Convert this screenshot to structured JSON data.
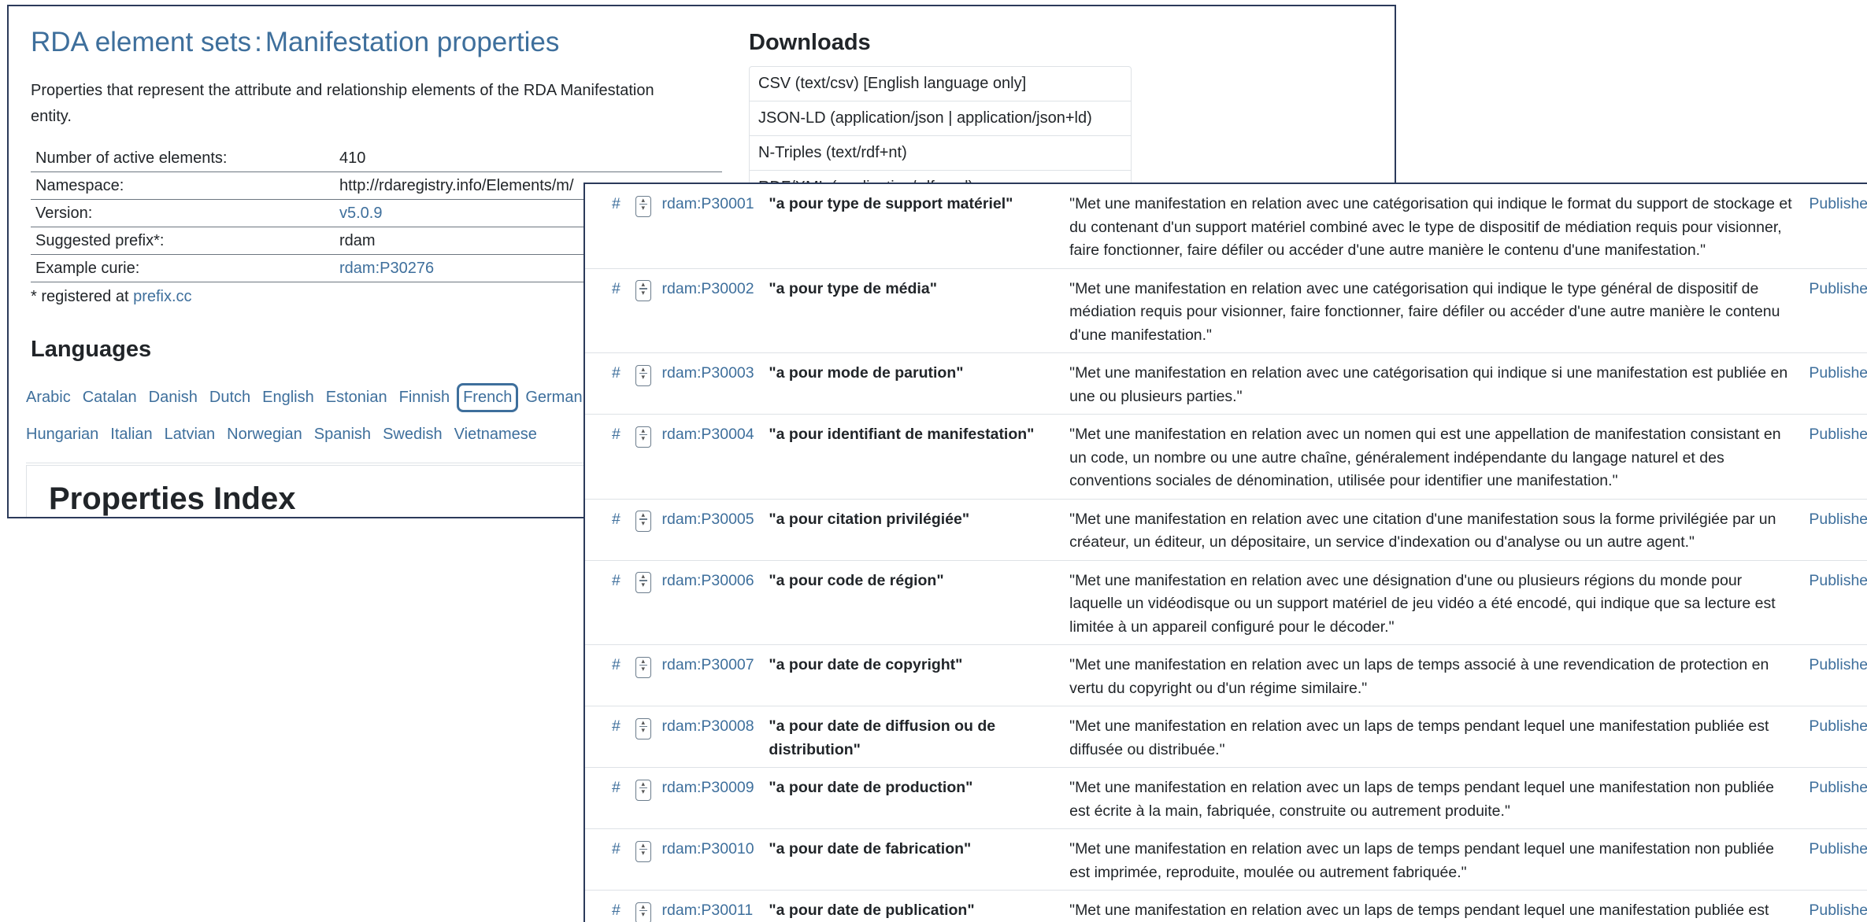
{
  "page": {
    "title_part1": "RDA element sets",
    "title_sep": ":",
    "title_part2": "Manifestation properties",
    "description": "Properties that represent the attribute and relationship elements of the RDA Manifestation entity."
  },
  "info": [
    {
      "key": "Number of active elements:",
      "value": "410",
      "is_link": false
    },
    {
      "key": "Namespace:",
      "value": "http://rdaregistry.info/Elements/m/",
      "is_link": false
    },
    {
      "key": "Version:",
      "value": "v5.0.9",
      "is_link": true
    },
    {
      "key": "Suggested prefix*:",
      "value": "rdam",
      "is_link": false
    },
    {
      "key": "Example curie:",
      "value": "rdam:P30276",
      "is_link": true
    }
  ],
  "registered": {
    "text": "* registered at",
    "link": "prefix.cc"
  },
  "languages": {
    "heading": "Languages",
    "row1": [
      "Arabic",
      "Catalan",
      "Danish",
      "Dutch",
      "English",
      "Estonian",
      "Finnish",
      "French",
      "German"
    ],
    "row2": [
      "Hungarian",
      "Italian",
      "Latvian",
      "Norwegian",
      "Spanish",
      "Swedish",
      "Vietnamese"
    ],
    "active": "French"
  },
  "properties_index": {
    "heading": "Properties Index"
  },
  "downloads": {
    "heading": "Downloads",
    "items": [
      "CSV (text/csv) [English language only]",
      "JSON-LD (application/json | application/json+ld)",
      "N-Triples (text/rdf+nt)",
      "RDF/XML (application/rdf+xml)"
    ]
  },
  "properties": [
    {
      "curie": "rdam:P30001",
      "label": "\"a pour type de support matériel\"",
      "definition": "\"Met une manifestation en relation avec une catégorisation qui indique le format du support de stockage et du contenant d'un support matériel combiné avec le type de dispositif de médiation requis pour visionner, faire fonctionner, faire défiler ou accéder d'une autre manière le contenu d'une manifestation.\"",
      "status": "Published"
    },
    {
      "curie": "rdam:P30002",
      "label": "\"a pour type de média\"",
      "definition": "\"Met une manifestation en relation avec une catégorisation qui indique le type général de dispositif de médiation requis pour visionner, faire fonctionner, faire défiler ou accéder d'une autre manière le contenu d'une manifestation.\"",
      "status": "Published"
    },
    {
      "curie": "rdam:P30003",
      "label": "\"a pour mode de parution\"",
      "definition": "\"Met une manifestation en relation avec une catégorisation qui indique si une manifestation est publiée en une ou plusieurs parties.\"",
      "status": "Published"
    },
    {
      "curie": "rdam:P30004",
      "label": "\"a pour identifiant de manifestation\"",
      "definition": "\"Met une manifestation en relation avec un nomen qui est une appellation de manifestation consistant en un code, un nombre ou une autre chaîne, généralement indépendante du langage naturel et des conventions sociales de dénomination, utilisée pour identifier une manifestation.\"",
      "status": "Published"
    },
    {
      "curie": "rdam:P30005",
      "label": "\"a pour citation privilégiée\"",
      "definition": "\"Met une manifestation en relation avec une citation d'une manifestation sous la forme privilégiée par un créateur, un éditeur, un dépositaire, un service d'indexation ou d'analyse ou un autre agent.\"",
      "status": "Published"
    },
    {
      "curie": "rdam:P30006",
      "label": "\"a pour code de région\"",
      "definition": "\"Met une manifestation en relation avec une désignation d'une ou plusieurs régions du monde pour laquelle un vidéodisque ou un support matériel de jeu vidéo a été encodé, qui indique que sa lecture est limitée à un appareil configuré pour le décoder.\"",
      "status": "Published"
    },
    {
      "curie": "rdam:P30007",
      "label": "\"a pour date de copyright\"",
      "definition": "\"Met une manifestation en relation avec un laps de temps associé à une revendication de protection en vertu du copyright ou d'un régime similaire.\"",
      "status": "Published"
    },
    {
      "curie": "rdam:P30008",
      "label": "\"a pour date de diffusion ou de distribution\"",
      "definition": "\"Met une manifestation en relation avec un laps de temps pendant lequel une manifestation publiée est diffusée ou distribuée.\"",
      "status": "Published"
    },
    {
      "curie": "rdam:P30009",
      "label": "\"a pour date de production\"",
      "definition": "\"Met une manifestation en relation avec un laps de temps pendant lequel une manifestation non publiée est écrite à la main, fabriquée, construite ou autrement produite.\"",
      "status": "Published"
    },
    {
      "curie": "rdam:P30010",
      "label": "\"a pour date de fabrication\"",
      "definition": "\"Met une manifestation en relation avec un laps de temps pendant lequel une manifestation non publiée est imprimée, reproduite, moulée ou autrement fabriquée.\"",
      "status": "Published"
    },
    {
      "curie": "rdam:P30011",
      "label": "\"a pour date de publication\"",
      "definition": "\"Met une manifestation en relation avec un laps de temps pendant lequel une manifestation publiée est publiée, mise à disposition ou éditée.\"",
      "status": "Published"
    }
  ]
}
